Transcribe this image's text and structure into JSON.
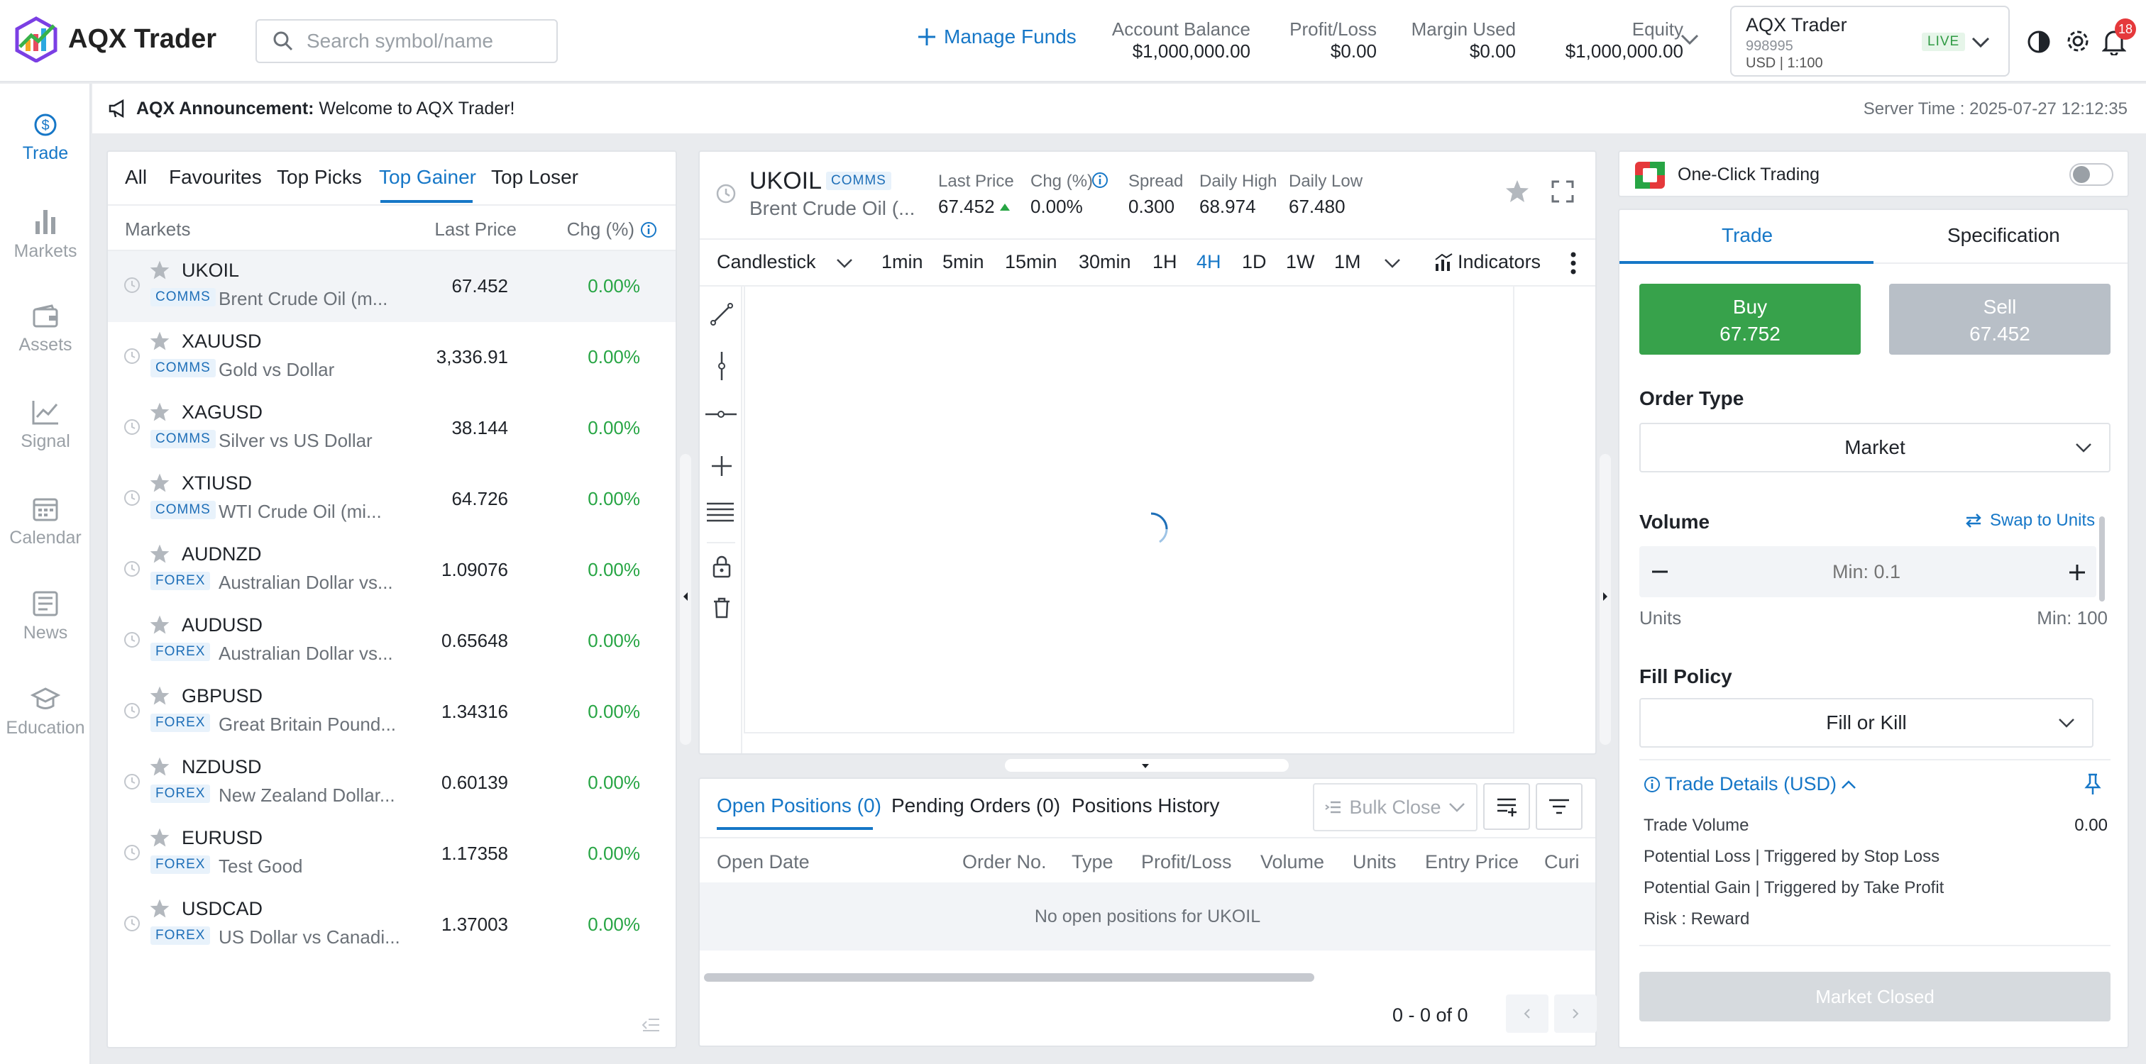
{
  "header": {
    "app_name": "AQX Trader",
    "search_placeholder": "Search symbol/name",
    "manage_funds": "Manage Funds",
    "stats": [
      {
        "label": "Account Balance",
        "value": "$1,000,000.00"
      },
      {
        "label": "Profit/Loss",
        "value": "$0.00"
      },
      {
        "label": "Margin Used",
        "value": "$0.00"
      },
      {
        "label": "Equity",
        "value": "$1,000,000.00"
      }
    ],
    "account": {
      "name": "AQX Trader",
      "id": "998995",
      "leverage": "USD | 1:100",
      "status": "LIVE"
    },
    "notification_count": "18"
  },
  "sidebar": {
    "items": [
      {
        "label": "Trade",
        "icon": "trade-icon",
        "active": true
      },
      {
        "label": "Markets",
        "icon": "bar-chart-icon"
      },
      {
        "label": "Assets",
        "icon": "wallet-icon"
      },
      {
        "label": "Signal",
        "icon": "line-chart-icon"
      },
      {
        "label": "Calendar",
        "icon": "calendar-icon"
      },
      {
        "label": "News",
        "icon": "news-icon"
      },
      {
        "label": "Education",
        "icon": "graduation-cap-icon"
      }
    ]
  },
  "announcement": {
    "title": "AQX Announcement:",
    "text": "Welcome to AQX Trader!",
    "server_time": "Server Time : 2025-07-27 12:12:35"
  },
  "markets": {
    "tabs": [
      "All",
      "Favourites",
      "Top Picks",
      "Top Gainer",
      "Top Loser"
    ],
    "active_tab": "Top Gainer",
    "columns": [
      "Markets",
      "Last Price",
      "Chg (%)"
    ],
    "rows": [
      {
        "symbol": "UKOIL",
        "category": "COMMS",
        "desc": "Brent Crude Oil (m...",
        "price": "67.452",
        "chg": "0.00%"
      },
      {
        "symbol": "XAUUSD",
        "category": "COMMS",
        "desc": "Gold vs Dollar",
        "price": "3,336.91",
        "chg": "0.00%"
      },
      {
        "symbol": "XAGUSD",
        "category": "COMMS",
        "desc": "Silver vs US Dollar",
        "price": "38.144",
        "chg": "0.00%"
      },
      {
        "symbol": "XTIUSD",
        "category": "COMMS",
        "desc": "WTI Crude Oil (mi...",
        "price": "64.726",
        "chg": "0.00%"
      },
      {
        "symbol": "AUDNZD",
        "category": "FOREX",
        "desc": "Australian Dollar vs...",
        "price": "1.09076",
        "chg": "0.00%"
      },
      {
        "symbol": "AUDUSD",
        "category": "FOREX",
        "desc": "Australian Dollar vs...",
        "price": "0.65648",
        "chg": "0.00%"
      },
      {
        "symbol": "GBPUSD",
        "category": "FOREX",
        "desc": "Great Britain Pound...",
        "price": "1.34316",
        "chg": "0.00%"
      },
      {
        "symbol": "NZDUSD",
        "category": "FOREX",
        "desc": "New Zealand Dollar...",
        "price": "0.60139",
        "chg": "0.00%"
      },
      {
        "symbol": "EURUSD",
        "category": "FOREX",
        "desc": "Test Good",
        "price": "1.17358",
        "chg": "0.00%"
      },
      {
        "symbol": "USDCAD",
        "category": "FOREX",
        "desc": "US Dollar vs Canadi...",
        "price": "1.37003",
        "chg": "0.00%"
      }
    ]
  },
  "chart": {
    "symbol": "UKOIL",
    "category": "COMMS",
    "desc": "Brent Crude Oil (...",
    "quote": {
      "last_price_label": "Last Price",
      "last_price": "67.452",
      "chg_label": "Chg (%)",
      "chg": "0.00%",
      "spread_label": "Spread",
      "spread": "0.300",
      "high_label": "Daily High",
      "high": "68.974",
      "low_label": "Daily Low",
      "low": "67.480"
    },
    "chart_type": "Candlestick",
    "timeframes": [
      "1min",
      "5min",
      "15min",
      "30min",
      "1H",
      "4H",
      "1D",
      "1W",
      "1M"
    ],
    "active_timeframe": "4H",
    "indicators": "Indicators"
  },
  "positions": {
    "tabs": [
      "Open Positions (0)",
      "Pending Orders (0)",
      "Positions History"
    ],
    "bulk_close": "Bulk Close",
    "columns": [
      "Open Date",
      "Order No.",
      "Type",
      "Profit/Loss",
      "Volume",
      "Units",
      "Entry Price",
      "Curi"
    ],
    "empty": "No open positions for UKOIL",
    "pagination": "0 - 0 of 0"
  },
  "trade": {
    "one_click": "One-Click Trading",
    "tabs": [
      "Trade",
      "Specification"
    ],
    "buy_label": "Buy",
    "buy_price": "67.752",
    "sell_label": "Sell",
    "sell_price": "67.452",
    "order_type_label": "Order Type",
    "order_type": "Market",
    "volume_label": "Volume",
    "swap": "Swap to Units",
    "volume_placeholder": "Min: 0.1",
    "units_label": "Units",
    "units_min": "Min: 100",
    "fill_policy_label": "Fill Policy",
    "fill_policy": "Fill or Kill",
    "details_title": "Trade Details (USD)",
    "details": [
      {
        "label": "Trade Volume",
        "value": "0.00"
      },
      {
        "label": "Potential Loss | Triggered by Stop Loss",
        "value": ""
      },
      {
        "label": "Potential Gain | Triggered by Take Profit",
        "value": ""
      },
      {
        "label": "Risk : Reward",
        "value": ""
      }
    ],
    "closed_button": "Market Closed"
  }
}
